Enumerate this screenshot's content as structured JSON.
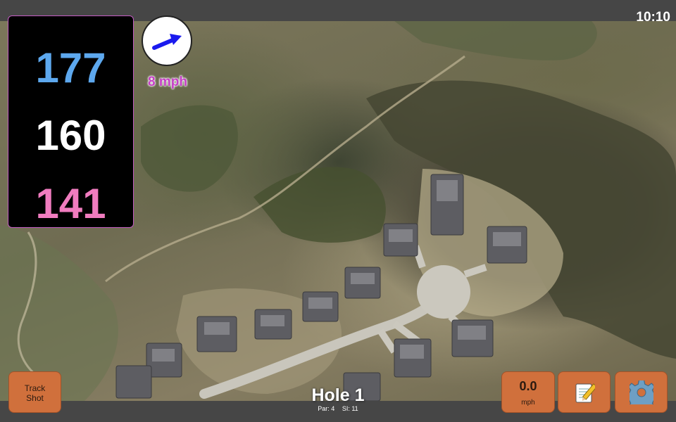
{
  "status": {
    "time": "10:10"
  },
  "yardages": {
    "back": "177",
    "middle": "160",
    "front": "141"
  },
  "wind": {
    "speed_label": "8 mph",
    "direction_icon": "wind-arrow-icon"
  },
  "hole": {
    "title": "Hole 1",
    "par_label": "Par: 4",
    "si_label": "SI: 11"
  },
  "buttons": {
    "track_line1": "Track",
    "track_line2": "Shot",
    "speed_value": "0.0",
    "speed_unit": "mph",
    "notes_icon": "notepad-icon",
    "settings_icon": "gear-icon"
  },
  "colors": {
    "back": "#5da8ee",
    "middle": "#ffffff",
    "front": "#f07cbf",
    "wind_text": "#c53fc5",
    "button": "#d0703c"
  }
}
